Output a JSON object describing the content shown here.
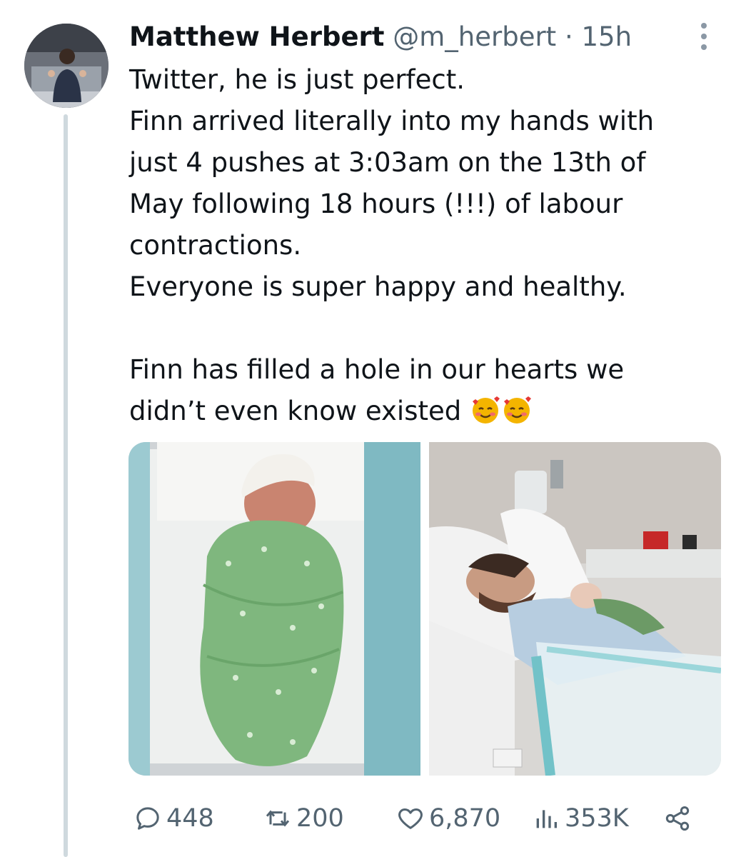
{
  "tweet": {
    "author_name": "Matthew Herbert",
    "author_handle": "@m_herbert",
    "separator": "·",
    "time": "15h",
    "text_lines": [
      "Twitter, he is just perfect.",
      "Finn arrived literally into my hands with",
      "just 4 pushes at 3:03am on the 13th of",
      "May following 18 hours (!!!) of labour",
      "contractions.",
      "Everyone is super happy and healthy.",
      "",
      "Finn has filled a hole in our hearts we",
      "didn’t even know existed"
    ],
    "emojis": [
      "smiling-face-with-hearts-icon",
      "smiling-face-with-hearts-icon"
    ]
  },
  "stats": {
    "replies": "448",
    "retweets": "200",
    "likes": "6,870",
    "views": "353K"
  },
  "colors": {
    "text": "#0f1419",
    "secondary": "#536471",
    "thread_line": "#cfd9de"
  }
}
